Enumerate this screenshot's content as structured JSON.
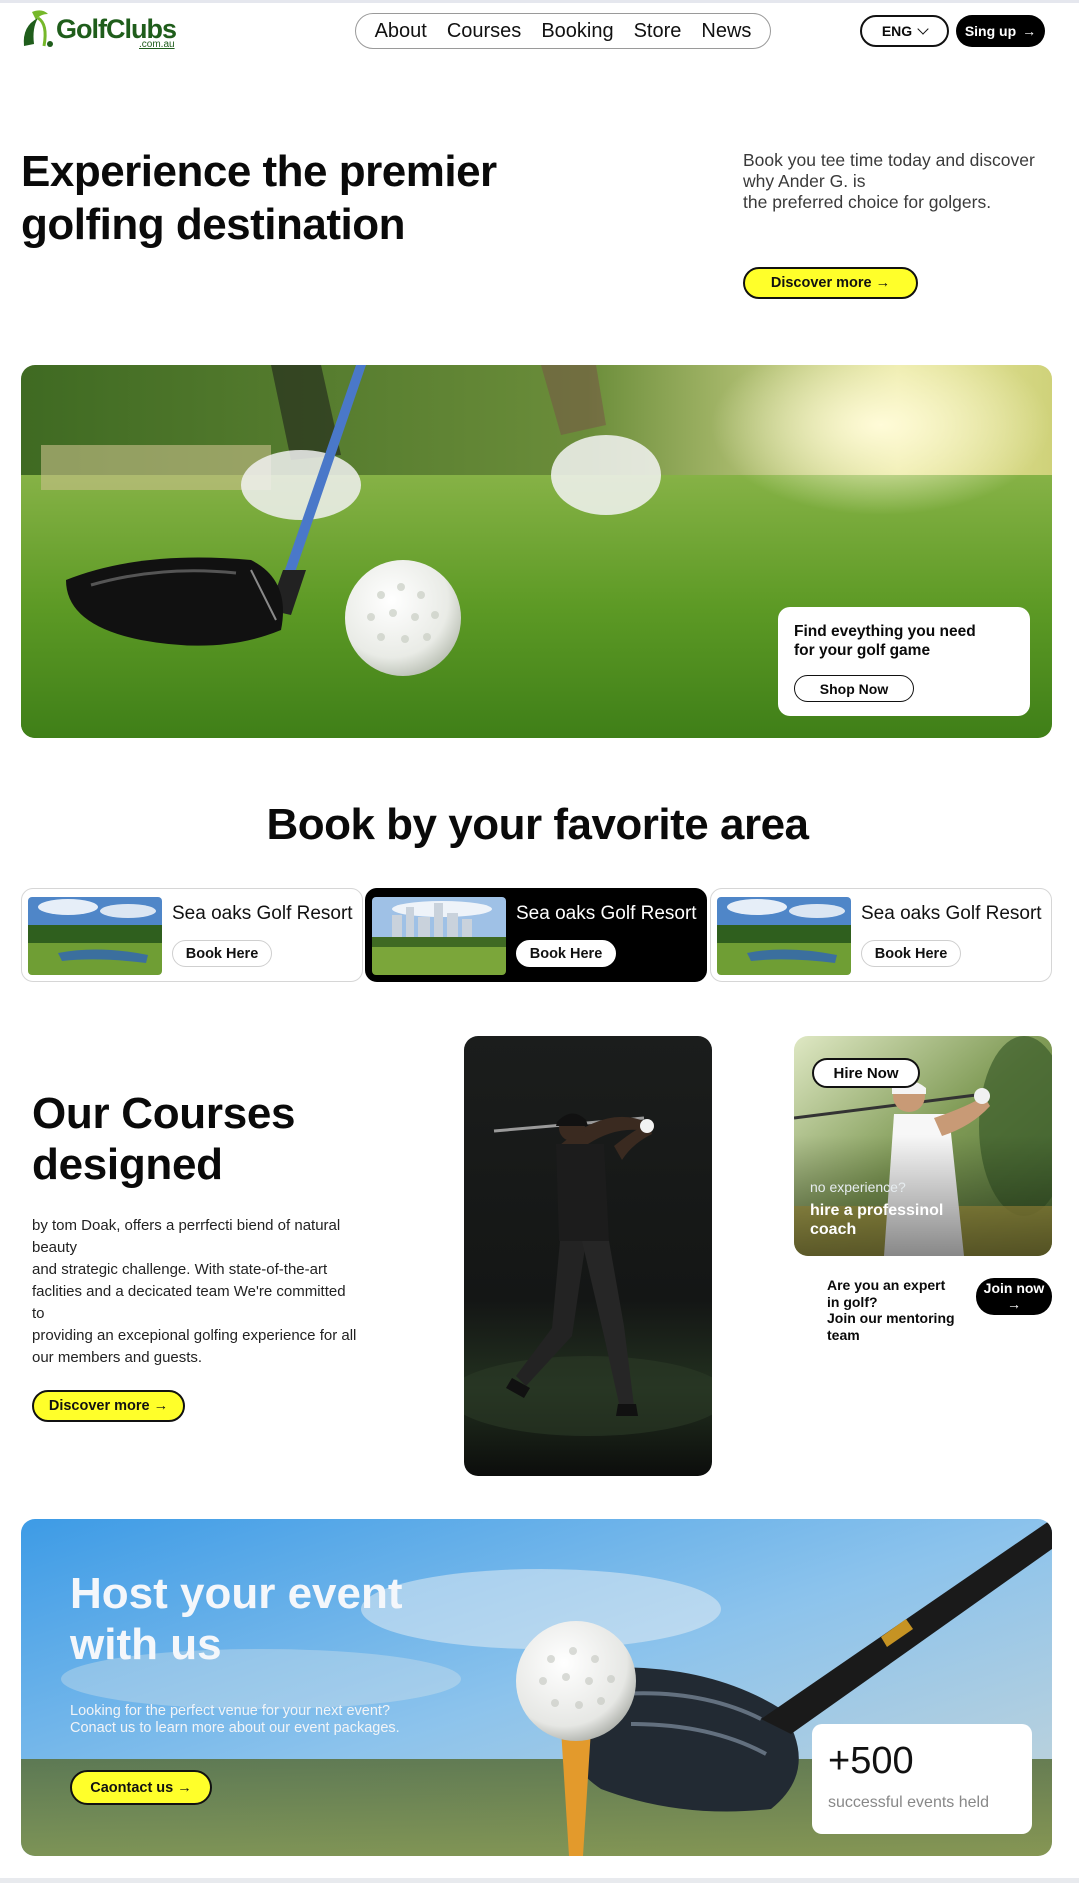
{
  "logo": {
    "name": "GolfClubs",
    "domain": ".com.au"
  },
  "nav": {
    "items": [
      "About",
      "Courses",
      "Booking",
      "Store",
      "News"
    ]
  },
  "header": {
    "language": "ENG",
    "signup_label": "Sing up",
    "arrow": "→"
  },
  "hero": {
    "title": "Experience the premier golfing destination",
    "description_lines": [
      "Book you tee time today and discover",
      "why Ander G. is",
      "the preferred choice for golgers."
    ],
    "cta_label": "Discover more →"
  },
  "banner": {
    "card_title": "Find eveything you need for your golf game",
    "shop_label": "Shop Now"
  },
  "areas": {
    "title": "Book by your favorite area",
    "cards": [
      {
        "name": "Sea oaks Golf Resort",
        "button": "Book Here"
      },
      {
        "name": "Sea oaks Golf Resort",
        "button": "Book Here"
      },
      {
        "name": "Sea oaks Golf Resort",
        "button": "Book Here"
      }
    ]
  },
  "courses": {
    "title": "Our Courses designed",
    "description_lines": [
      "by tom Doak, offers a perrfecti biend of natural",
      "beauty",
      "and strategic challenge. With state-of-the-art",
      "faclities and a decicated team We're committed",
      "to",
      "providing an excepional golfing experience for all",
      "our members and guests."
    ],
    "cta_label": "Discover more →"
  },
  "coach": {
    "hire_label": "Hire Now",
    "small_text": "no experience?",
    "big_text": "hire a professinol coach",
    "expert_lines": [
      "Are you an expert",
      "in golf?",
      "Join our mentoring",
      "team"
    ],
    "join_label": "Join now →"
  },
  "event": {
    "title": "Host your event with us",
    "description_lines": [
      "Looking for the perfect venue for your next event?",
      "Conact us to learn more about our event packages."
    ],
    "cta_label": "Caontact us  →",
    "stat_value": "+500",
    "stat_label": "successful events held"
  },
  "colors": {
    "accent": "#ffff2a",
    "dark": "#000000",
    "brand": "#1f5d1b"
  }
}
